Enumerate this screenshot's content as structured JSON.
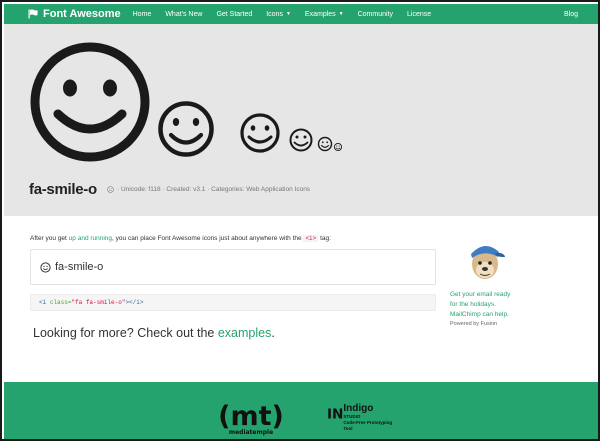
{
  "navbar": {
    "brand": "Font Awesome",
    "items": [
      {
        "label": "Home"
      },
      {
        "label": "What's New"
      },
      {
        "label": "Get Started"
      },
      {
        "label": "Icons",
        "dropdown": true
      },
      {
        "label": "Examples",
        "dropdown": true
      },
      {
        "label": "Community"
      },
      {
        "label": "License"
      }
    ],
    "right_link": "Blog"
  },
  "hero": {
    "icon_name": "fa-smile-o",
    "meta": "· Unicode: f118 · Created: v3.1 · Categories: Web Application Icons"
  },
  "content": {
    "intro_prefix": "After you get",
    "intro_link": "up and running",
    "intro_middle": ", you can place Font Awesome icons just about anywhere with the",
    "intro_tag": "<i>",
    "intro_suffix": "tag:",
    "demo_label": "fa-smile-o",
    "code_tag_open": "<i",
    "code_attr": "class=",
    "code_value": "\"fa fa-smile-o\"",
    "code_tag_close": "></i>",
    "more_prefix": "Looking for more? Check out the",
    "more_link": "examples",
    "more_suffix": "."
  },
  "ad": {
    "line1": "Get your email ready",
    "line2": "for the holidays.",
    "line3": "MailChimp can help.",
    "powered": "Powered by Fusion"
  },
  "footer": {
    "sponsor1_main": "(mt)",
    "sponsor1_sub": "mediatemple",
    "sponsor2_logo": "IN",
    "sponsor2_name": "Indigo",
    "sponsor2_studio": "STUDIO",
    "sponsor2_tagline": "Code-Free Prototyping Tool"
  },
  "colors": {
    "brand_green": "#25a36f",
    "hero_bg": "#e6e6e6"
  }
}
